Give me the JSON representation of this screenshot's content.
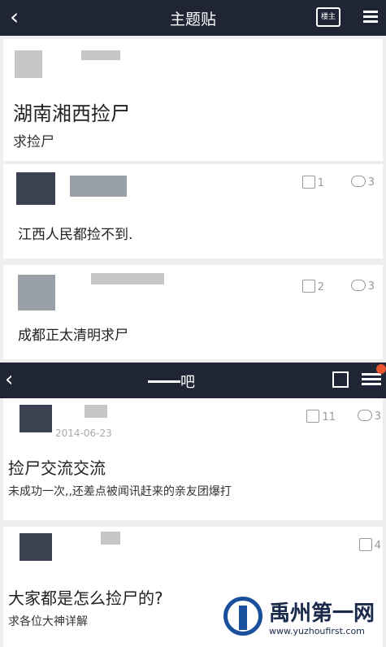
{
  "topbar": {
    "title": "主题贴",
    "back_icon": "back-arrow-icon",
    "owner_button": "楼主"
  },
  "post": {
    "title": "湖南湘西捡尸",
    "subtitle": "求捡尸"
  },
  "replies": [
    {
      "text": "江西人民都捡不到.",
      "likes": "1",
      "comments": "3"
    },
    {
      "text": "成都正太清明求尸",
      "likes": "2",
      "comments": "3"
    }
  ],
  "forum_bar": {
    "title": "吧"
  },
  "forum_posts": [
    {
      "date": "2014-06-23",
      "title": "捡尸交流交流",
      "excerpt": "未成功一次,,还差点被闻讯赶来的亲友团爆打",
      "likes": "11",
      "comments": "3"
    },
    {
      "title": "大家都是怎么捡尸的?",
      "excerpt": "求各位大神详解",
      "likes": "4"
    }
  ],
  "watermark": {
    "name": "禹州第一网",
    "url": "www.yuzhoufirst.com"
  }
}
